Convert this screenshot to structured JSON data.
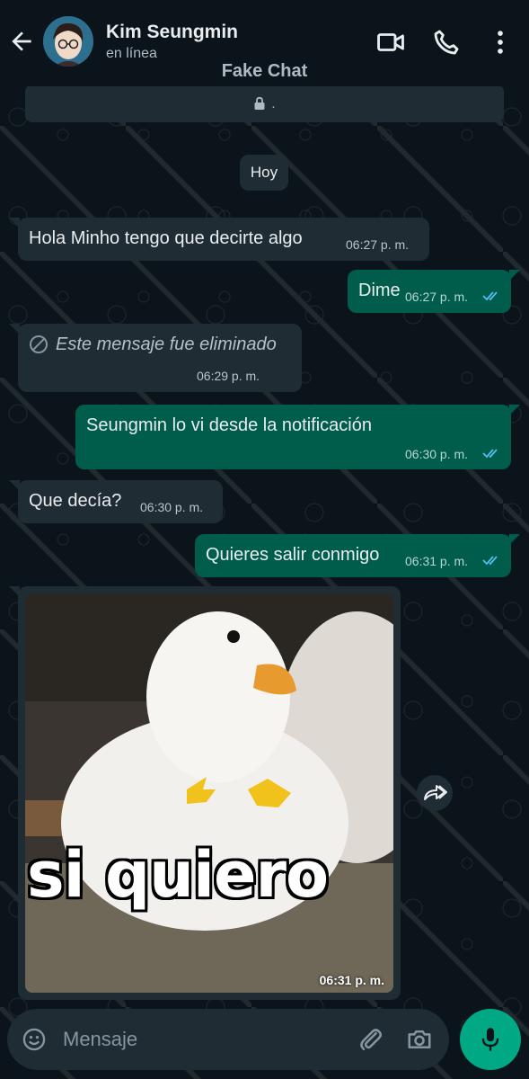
{
  "header": {
    "contact_name": "Kim Seungmin",
    "status": "en línea",
    "banner_title": "Fake Chat",
    "encryption_note": "."
  },
  "day_label": "Hoy",
  "messages": [
    {
      "direction": "in",
      "text": "Hola Minho tengo que decirte algo",
      "time": "06:27 p. m."
    },
    {
      "direction": "out",
      "text": "Dime",
      "time": "06:27 p. m.",
      "read": true
    },
    {
      "direction": "in",
      "text": "Este mensaje fue eliminado",
      "time": "06:29 p. m.",
      "deleted": true
    },
    {
      "direction": "out",
      "text": "Seungmin lo vi desde la notificación",
      "time": "06:30 p. m.",
      "read": true
    },
    {
      "direction": "in",
      "text": "Que decía?",
      "time": "06:30 p. m."
    },
    {
      "direction": "out",
      "text": "Quieres salir conmigo",
      "time": "06:31 p. m.",
      "read": true
    },
    {
      "direction": "in",
      "type": "image",
      "caption_in_image": "si quiero",
      "time": "06:31 p. m."
    }
  ],
  "composer": {
    "placeholder": "Mensaje"
  },
  "colors": {
    "background": "#0b141a",
    "incoming_bubble": "#1f2c33",
    "outgoing_bubble": "#005c4b",
    "accent": "#00a884",
    "read_ticks": "#53bdeb"
  },
  "icons": [
    "back-arrow-icon",
    "video-call-icon",
    "phone-icon",
    "more-vert-icon",
    "lock-icon",
    "blocked-icon",
    "double-check-icon",
    "forward-icon",
    "emoji-icon",
    "attach-icon",
    "camera-icon",
    "mic-icon"
  ]
}
